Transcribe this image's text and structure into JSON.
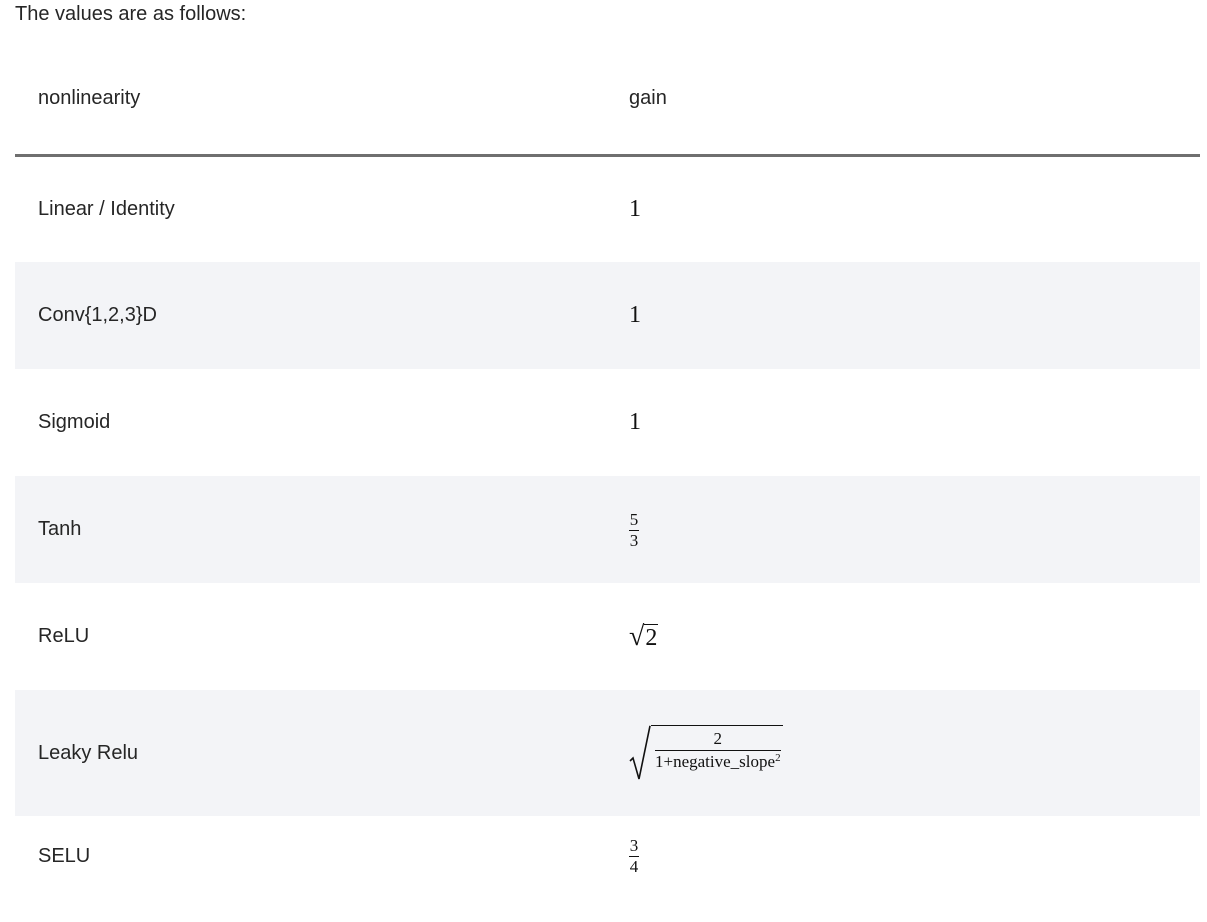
{
  "intro": "The values are as follows:",
  "table": {
    "headers": {
      "nonlinearity": "nonlinearity",
      "gain": "gain"
    },
    "rows": [
      {
        "nonlinearity": "Linear / Identity",
        "gain": "1"
      },
      {
        "nonlinearity": "Conv{1,2,3}D",
        "gain": "1"
      },
      {
        "nonlinearity": "Sigmoid",
        "gain": "1"
      },
      {
        "nonlinearity": "Tanh",
        "gain_num": "5",
        "gain_den": "3"
      },
      {
        "nonlinearity": "ReLU",
        "gain_radicand": "2"
      },
      {
        "nonlinearity": "Leaky Relu",
        "gain_num": "2",
        "gain_den_base": "1+negative_slope",
        "gain_den_exp": "2"
      },
      {
        "nonlinearity": "SELU",
        "gain_num": "3",
        "gain_den": "4"
      }
    ]
  }
}
